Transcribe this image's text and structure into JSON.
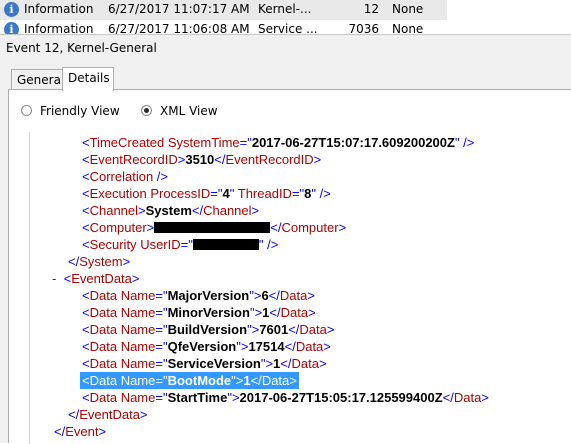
{
  "event_list": {
    "rows": [
      {
        "level": "Information",
        "date": "6/27/2017 11:07:17 AM",
        "source": "Kernel-...",
        "event_id": "12",
        "task": "None"
      },
      {
        "level": "Information",
        "date": "6/27/2017 11:06:08 AM",
        "source": "Service ...",
        "event_id": "7036",
        "task": "None"
      }
    ]
  },
  "pane": {
    "title": "Event 12, Kernel-General"
  },
  "tabs": {
    "general": "General",
    "details": "Details"
  },
  "view": {
    "friendly": "Friendly View",
    "xml": "XML View",
    "selected": "XML View"
  },
  "xml": {
    "time_created_tag": "TimeCreated",
    "system_time_attr": "SystemTime",
    "system_time_val": "2017-06-27T15:07:17.609200200Z",
    "event_record_id_tag": "EventRecordID",
    "event_record_id_val": "3510",
    "correlation_tag": "Correlation",
    "execution_tag": "Execution",
    "process_id_attr": "ProcessID",
    "process_id_val": "4",
    "thread_id_attr": "ThreadID",
    "thread_id_val": "8",
    "channel_tag": "Channel",
    "channel_val": "System",
    "computer_tag": "Computer",
    "security_tag": "Security",
    "user_id_attr": "UserID",
    "system_tag": "System",
    "event_data_tag": "EventData",
    "data_tag": "Data",
    "name_attr": "Name",
    "data_items": [
      {
        "name": "MajorVersion",
        "value": "6"
      },
      {
        "name": "MinorVersion",
        "value": "1"
      },
      {
        "name": "BuildVersion",
        "value": "7601"
      },
      {
        "name": "QfeVersion",
        "value": "17514"
      },
      {
        "name": "ServiceVersion",
        "value": "1"
      },
      {
        "name": "BootMode",
        "value": "1"
      },
      {
        "name": "StartTime",
        "value": "2017-06-27T15:05:17.125599400Z"
      }
    ],
    "event_tag": "Event"
  },
  "colors": {
    "tag": "#b00000",
    "punct": "#0000ff",
    "highlight": "#3399ff"
  },
  "icons": {
    "info": "info-circle-icon"
  }
}
